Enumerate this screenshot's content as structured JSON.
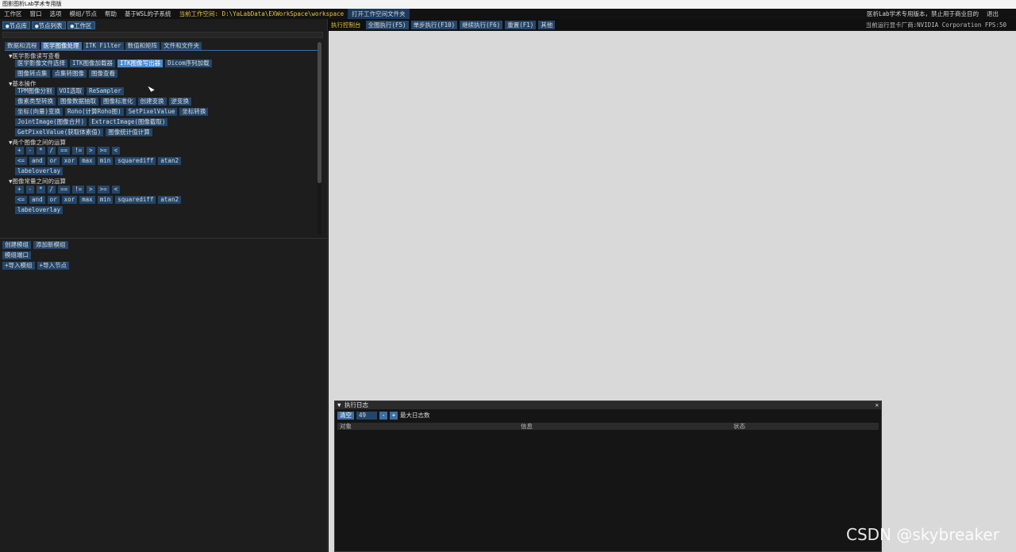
{
  "window": {
    "title": "图影图析Lab学术专用版"
  },
  "menubar": {
    "items": [
      "工作区",
      "窗口",
      "选项",
      "模组/节点",
      "帮助",
      "基于WSL的子系统"
    ],
    "workspace_path": "当前工作空间: D:\\YaLabData\\EXWorkSpace\\workspace",
    "open_folder": "打开工作空间文件夹",
    "notice": "医析Lab学术专用版本，禁止用于商业目的",
    "exit": "退出"
  },
  "left_panel": {
    "tabs": [
      "●节点库",
      "●节点列表",
      "●工作区"
    ],
    "category_tabs": [
      "数据和流程",
      "医学图像处理",
      "ITK Filter",
      "数值和矩阵",
      "文件和文件夹"
    ],
    "active_category": 1,
    "sections": {
      "medical_io": {
        "title": "医学影像读写查看",
        "row1": [
          "医学影像文件选择",
          "ITK图像加载器",
          "ITK图像写出器",
          "Dicom序列加载"
        ],
        "row2": [
          "图像转点集",
          "点集转图像",
          "图像查看"
        ]
      },
      "basic_ops": {
        "title": "基本操作",
        "row1": [
          "TPM图像分割",
          "VOI选取",
          "ReSampler"
        ],
        "row2": [
          "像素类型转换",
          "图像数据抽取",
          "图像标准化",
          "创建变换",
          "逆变换"
        ],
        "row3": [
          "坐标(向量)变换",
          "Roho(计算Roho图)",
          "SetPixelValue",
          "坐标转换"
        ],
        "row4": [
          "JointImage(图像合并)",
          "ExtractImage(图像截取)"
        ],
        "row5": [
          "GetPixelValue(获取体素值)",
          "图像统计值计算"
        ]
      },
      "two_image_ops": {
        "title": "两个图像之间的运算",
        "row1": [
          "+",
          "-",
          "*",
          "/",
          "==",
          "!=",
          ">",
          ">=",
          "<"
        ],
        "row2": [
          "<=",
          "and",
          "or",
          "xor",
          "max",
          "min",
          "squarediff",
          "atan2"
        ],
        "row3": [
          "labeloverlay"
        ]
      },
      "image_const_ops": {
        "title": "图像常量之间的运算",
        "row1": [
          "+",
          "-",
          "*",
          "/",
          "==",
          "!=",
          ">",
          ">=",
          "<"
        ],
        "row2": [
          "<=",
          "and",
          "or",
          "xor",
          "max",
          "min",
          "squarediff",
          "atan2"
        ],
        "row3": [
          "labeloverlay"
        ]
      }
    },
    "bottom_buttons": {
      "row1": [
        "创建模组",
        "添加新模组"
      ],
      "row2": [
        "模组端口"
      ],
      "row3": [
        "+导入模组",
        "+导入节点"
      ]
    }
  },
  "right_toolbar": {
    "label": "执行控制台",
    "buttons": [
      "全图执行(F5)",
      "单步执行(F10)",
      "继续执行(F6)",
      "重置(F1)",
      "其他"
    ],
    "info": "当前运行显卡厂商:NVIDIA Corporation FPS:50"
  },
  "log_window": {
    "title": "▼ 执行日志",
    "clear": "清空",
    "max_value": "49",
    "minus": "-",
    "plus": "+",
    "max_label": "最大日志数",
    "columns": [
      "对象",
      "信息",
      "状态"
    ],
    "close": "✕"
  },
  "watermark": "CSDN @skybreaker",
  "colors": {
    "accent": "#24466a",
    "highlight": "#4a8ad0",
    "path_text": "#e8c341",
    "canvas": "#d9d9d9"
  }
}
